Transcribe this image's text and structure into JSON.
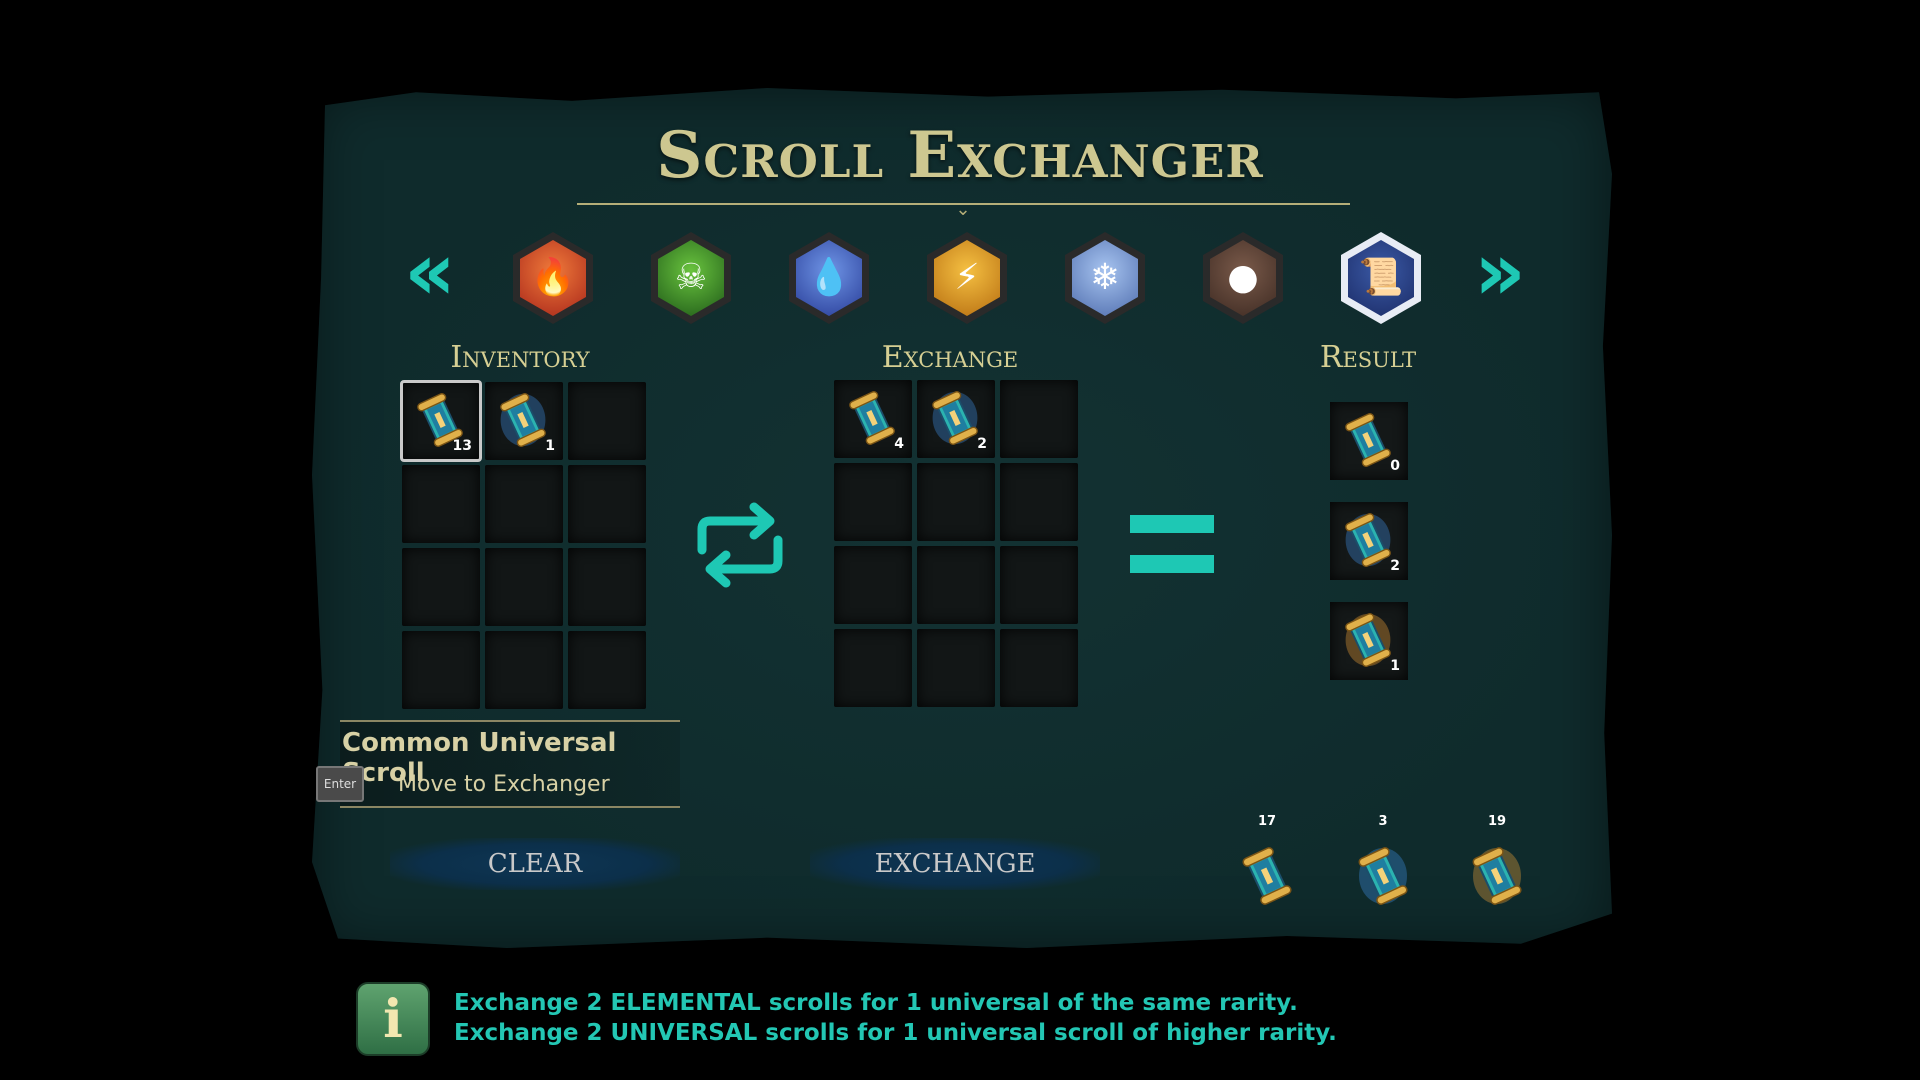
{
  "title": "Scroll Exchanger",
  "tabs": [
    {
      "name": "fire",
      "icon": "fire-icon",
      "glyph": "🔥",
      "colors": [
        "#f07a3a",
        "#a8261a"
      ]
    },
    {
      "name": "poison",
      "icon": "skull-icon",
      "glyph": "☠",
      "colors": [
        "#69c33e",
        "#1f5a18"
      ]
    },
    {
      "name": "water",
      "icon": "water-drop-icon",
      "glyph": "💧",
      "colors": [
        "#6f95e6",
        "#283c97"
      ]
    },
    {
      "name": "lightning",
      "icon": "lightning-icon",
      "glyph": "⚡",
      "colors": [
        "#f5c042",
        "#b66d10"
      ]
    },
    {
      "name": "ice",
      "icon": "snowflake-icon",
      "glyph": "❄",
      "colors": [
        "#a7c4f0",
        "#4f6dad"
      ]
    },
    {
      "name": "earth",
      "icon": "rock-icon",
      "glyph": "●",
      "colors": [
        "#7a5a4a",
        "#3d2a22"
      ]
    },
    {
      "name": "universal",
      "icon": "scroll-icon",
      "glyph": "📜",
      "colors": [
        "#3b5aa6",
        "#1b2b66"
      ],
      "selected": true
    }
  ],
  "labels": {
    "inventory": "Inventory",
    "exchange": "Exchange",
    "result": "Result"
  },
  "inventory": [
    {
      "count": "13",
      "rarity": "common",
      "selected": true
    },
    {
      "count": "1",
      "rarity": "rare"
    }
  ],
  "exchange_slots": [
    {
      "count": "4",
      "rarity": "common"
    },
    {
      "count": "2",
      "rarity": "rare"
    }
  ],
  "results": [
    {
      "count": "0",
      "rarity": "common"
    },
    {
      "count": "2",
      "rarity": "rare"
    },
    {
      "count": "1",
      "rarity": "epic"
    }
  ],
  "tooltip": {
    "name": "Common Universal Scroll",
    "key": "Enter",
    "hint": "Move to Exchanger"
  },
  "buttons": {
    "clear": "CLEAR",
    "exchange": "EXCHANGE"
  },
  "totals": [
    {
      "count": "17",
      "rarity": "common"
    },
    {
      "count": "3",
      "rarity": "rare"
    },
    {
      "count": "19",
      "rarity": "epic"
    }
  ],
  "info": {
    "line1": "Exchange 2 ELEMENTAL scrolls for 1 universal of the same rarity.",
    "line2": "Exchange 2 UNIVERSAL scrolls for 1 universal scroll of higher rarity."
  },
  "colors": {
    "accent": "#1ec8b4",
    "panel": "#0f2b2c",
    "title": "#cdc790"
  }
}
